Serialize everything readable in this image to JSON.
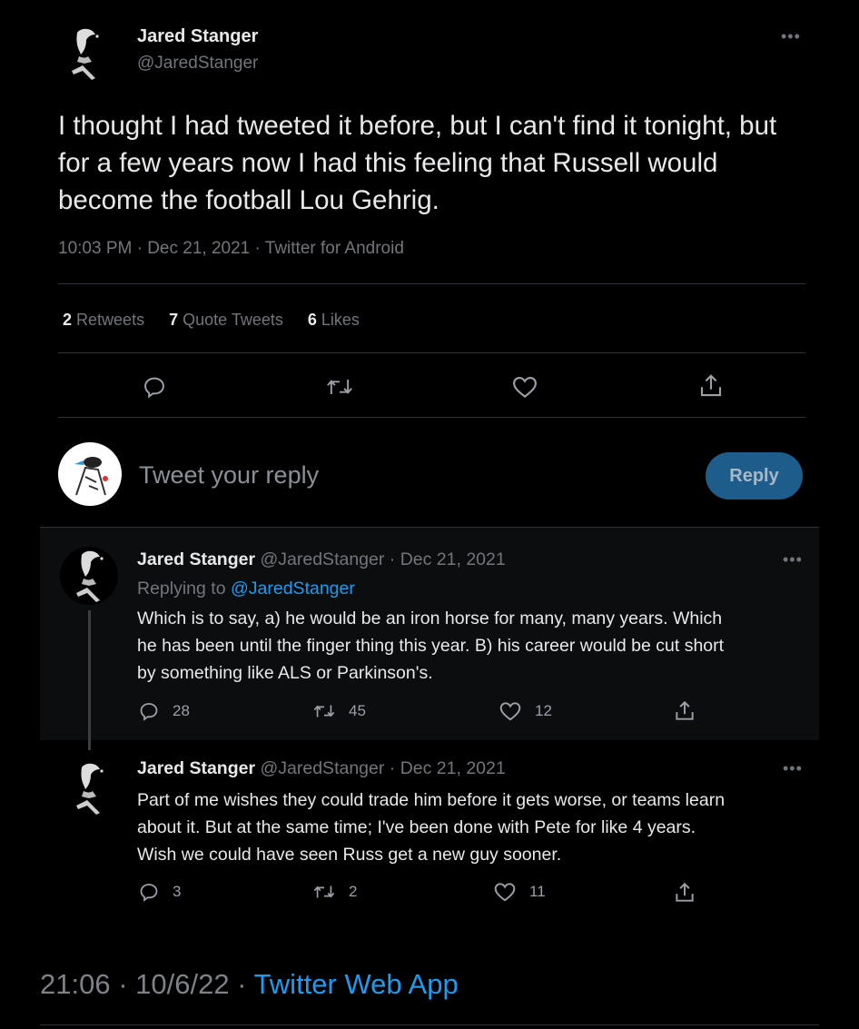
{
  "main_tweet": {
    "author_name": "Jared Stanger",
    "author_handle": "@JaredStanger",
    "text": "I thought I had tweeted it before, but I can't find it tonight, but for a few years now I had this feeling that Russell would become the football Lou Gehrig.",
    "meta": "10:03 PM · Dec 21, 2021 · Twitter for Android",
    "stats": {
      "retweets_count": "2",
      "retweets_label": "Retweets",
      "quotes_count": "7",
      "quotes_label": "Quote Tweets",
      "likes_count": "6",
      "likes_label": "Likes"
    }
  },
  "compose": {
    "placeholder": "Tweet your reply",
    "reply_button": "Reply"
  },
  "replies": [
    {
      "author_name": "Jared Stanger",
      "author_handle": "@JaredStanger",
      "date": "· Dec 21, 2021",
      "replying_prefix": "Replying to",
      "replying_handle": "@JaredStanger",
      "lines": [
        "Which is to say, a) he would be an iron horse for many, many years. Which",
        "he has been until the finger thing this year. B) his career would be cut short",
        "by something like ALS or Parkinson's."
      ],
      "reply_count": "28",
      "retweet_count": "45",
      "like_count": "12"
    },
    {
      "author_name": "Jared Stanger",
      "author_handle": "@JaredStanger",
      "date": "· Dec 21, 2021",
      "lines": [
        "Part of me wishes they could trade him before it gets worse, or teams learn",
        "about it. But at the same time; I've been done with Pete for like 4 years.",
        "Wish we could have seen Russ get a new guy sooner."
      ],
      "reply_count": "3",
      "retweet_count": "2",
      "like_count": "11"
    }
  ],
  "footer": {
    "timestamp": "21:06 · 10/6/22 ·",
    "client": "Twitter Web App"
  },
  "colors": {
    "background": "#000000",
    "accent": "#1d9bf0",
    "reply_button": "#1e5c8c",
    "secondary_text": "#71767b"
  }
}
